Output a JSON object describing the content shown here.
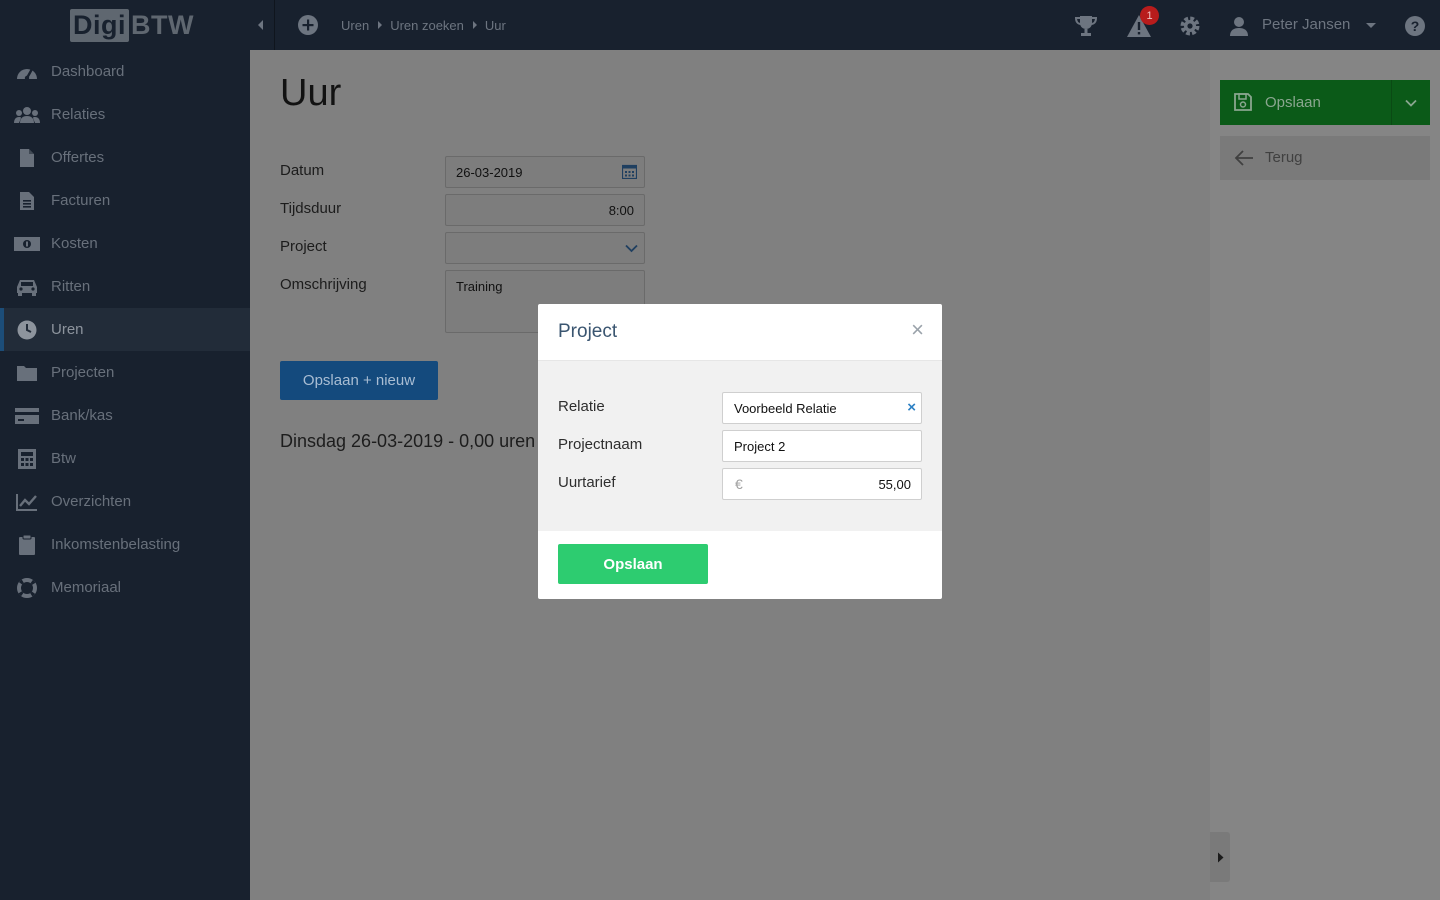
{
  "app": {
    "logo_part1": "Digi",
    "logo_part2": "BTW"
  },
  "topbar": {
    "breadcrumb": [
      "Uren",
      "Uren zoeken",
      "Uur"
    ],
    "notification_count": "1",
    "user_name": "Peter Jansen"
  },
  "sidebar": {
    "items": [
      {
        "label": "Dashboard",
        "icon": "dashboard-icon"
      },
      {
        "label": "Relaties",
        "icon": "users-icon"
      },
      {
        "label": "Offertes",
        "icon": "file-icon"
      },
      {
        "label": "Facturen",
        "icon": "invoice-icon"
      },
      {
        "label": "Kosten",
        "icon": "money-icon"
      },
      {
        "label": "Ritten",
        "icon": "car-icon"
      },
      {
        "label": "Uren",
        "icon": "clock-icon",
        "active": true
      },
      {
        "label": "Projecten",
        "icon": "folder-icon"
      },
      {
        "label": "Bank/kas",
        "icon": "credit-card-icon"
      },
      {
        "label": "Btw",
        "icon": "calculator-icon"
      },
      {
        "label": "Overzichten",
        "icon": "chart-icon"
      },
      {
        "label": "Inkomstenbelasting",
        "icon": "clipboard-icon"
      },
      {
        "label": "Memoriaal",
        "icon": "life-ring-icon"
      }
    ]
  },
  "page": {
    "title": "Uur",
    "form": {
      "datum_label": "Datum",
      "datum_value": "26-03-2019",
      "tijdsduur_label": "Tijdsduur",
      "tijdsduur_value": "8:00",
      "project_label": "Project",
      "project_value": "",
      "omschrijving_label": "Omschrijving",
      "omschrijving_value": "Training"
    },
    "save_new_label": "Opslaan + nieuw",
    "day_summary": "Dinsdag 26-03-2019 - 0,00 uren"
  },
  "right_panel": {
    "save_label": "Opslaan",
    "back_label": "Terug"
  },
  "modal": {
    "title": "Project",
    "close": "×",
    "relatie_label": "Relatie",
    "relatie_value": "Voorbeeld Relatie",
    "clear": "×",
    "projectnaam_label": "Projectnaam",
    "projectnaam_value": "Project 2",
    "uurtarief_label": "Uurtarief",
    "currency": "€",
    "uurtarief_value": "55,00",
    "save_label": "Opslaan"
  },
  "colors": {
    "topbar_bg": "#18212e",
    "overlay_main": "#808080",
    "modal_save_green": "#2dcc70",
    "primary_blue": "#144a7d",
    "accent_blue": "#2c80c4"
  }
}
